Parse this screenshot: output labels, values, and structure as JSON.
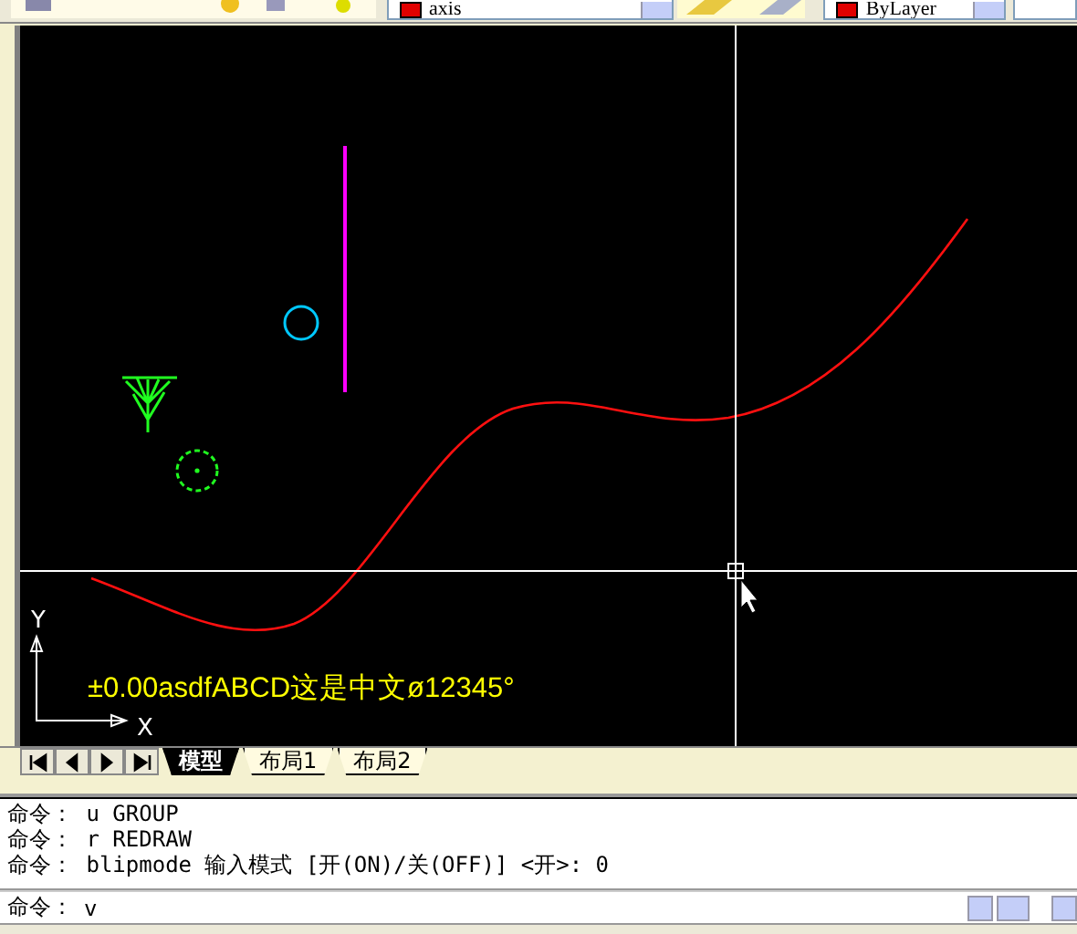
{
  "toolbar": {
    "layer": "axis",
    "color_control": "ByLayer"
  },
  "canvas": {
    "annotation": "±0.00asdfABCD这是中文ø12345°",
    "axis_x": "X",
    "axis_y": "Y"
  },
  "layout_tabs": [
    {
      "label": "模型",
      "selected": true
    },
    {
      "label": "布局1",
      "selected": false
    },
    {
      "label": "布局2",
      "selected": false
    }
  ],
  "command_history": [
    "命令： u GROUP",
    "命令： r REDRAW",
    "命令： blipmode 输入模式 [开(ON)/关(OFF)] <开>: 0"
  ],
  "command_line": {
    "prompt": "命令：",
    "value": "v"
  }
}
